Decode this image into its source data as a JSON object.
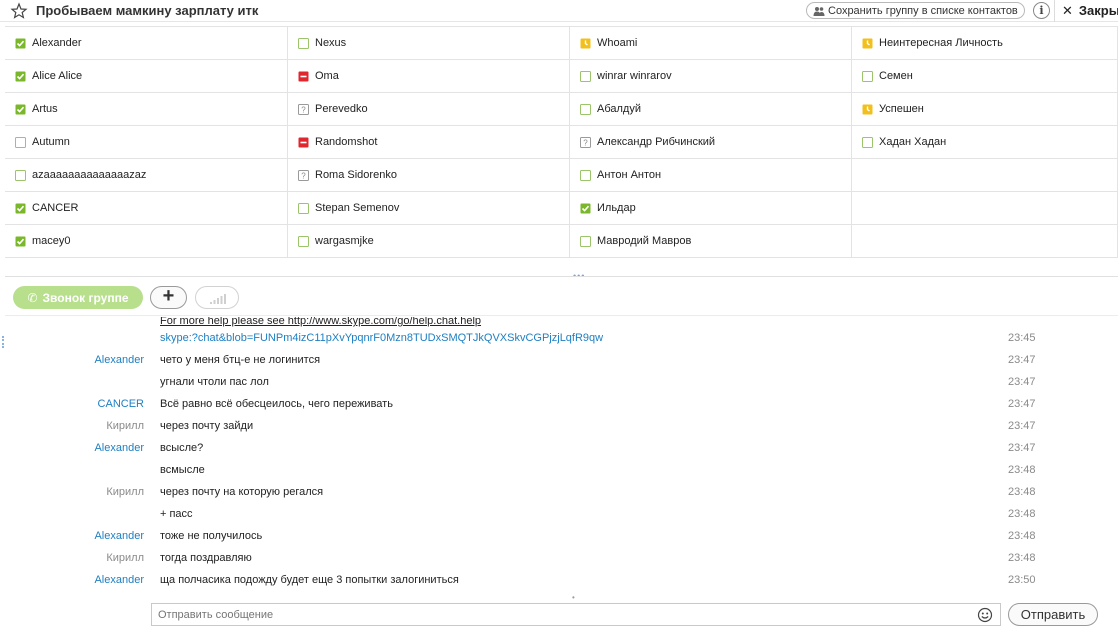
{
  "header": {
    "title": "Пробываем мамкину зарплату итк",
    "save_group_label": "Сохранить группу в списке контактов",
    "info_label": "i",
    "close_label": "Закры"
  },
  "colors": {
    "online": "#7ab72b",
    "away": "#f2c01c",
    "busy": "#e0262e",
    "offline_outline": "#9cc46a",
    "unknown": "#9a9a9a",
    "link": "#1d7fc2",
    "call_button": "#b7df8c"
  },
  "participants": [
    [
      {
        "name": "Alexander",
        "status": "online"
      },
      {
        "name": "Alice Alice",
        "status": "online"
      },
      {
        "name": "Artus",
        "status": "online"
      },
      {
        "name": "Autumn",
        "status": "offline"
      },
      {
        "name": "azaaaaaaaaaaaaaazaz",
        "status": "offline"
      },
      {
        "name": "CANCER",
        "status": "online"
      },
      {
        "name": "macey0",
        "status": "online"
      }
    ],
    [
      {
        "name": "Nexus",
        "status": "offline"
      },
      {
        "name": "Oma",
        "status": "busy"
      },
      {
        "name": "Perevedko",
        "status": "unknown"
      },
      {
        "name": "Randomshot",
        "status": "busy"
      },
      {
        "name": "Roma Sidorenko",
        "status": "unknown"
      },
      {
        "name": "Stepan Semenov",
        "status": "offline"
      },
      {
        "name": "wargasmjke",
        "status": "offline"
      }
    ],
    [
      {
        "name": "Whoami",
        "status": "away"
      },
      {
        "name": "winrar winrarov",
        "status": "offline"
      },
      {
        "name": "Абалдуй",
        "status": "offline"
      },
      {
        "name": "Александр Рибчинский",
        "status": "unknown"
      },
      {
        "name": "Антон Антон",
        "status": "offline"
      },
      {
        "name": "Ильдар",
        "status": "online"
      },
      {
        "name": "Мавродий Мавров",
        "status": "offline"
      }
    ],
    [
      {
        "name": "Неинтересная Личность",
        "status": "away"
      },
      {
        "name": "Семен",
        "status": "offline"
      },
      {
        "name": "Успешен",
        "status": "away"
      },
      {
        "name": "Хадан Хадан",
        "status": "offline"
      },
      {
        "name": "",
        "status": "none"
      },
      {
        "name": "",
        "status": "none"
      },
      {
        "name": "",
        "status": "none"
      }
    ]
  ],
  "toolbar": {
    "call_group_label": "Звонок группе",
    "add_label": "+"
  },
  "messages": [
    {
      "author": "",
      "author_style": "gray",
      "text": "For more help please see http://www.skype.com/go/help.chat.help",
      "text_style": "partial",
      "time": ""
    },
    {
      "author": "",
      "author_style": "gray",
      "text": "skype:?chat&blob=FUNPm4izC11pXvYpqnrF0Mzn8TUDxSMQTJkQVXSkvCGPjzjLqfR9qw",
      "text_style": "link",
      "time": "23:45"
    },
    {
      "author": "Alexander",
      "author_style": "blue",
      "text": "чето у меня бтц-е не логинится",
      "text_style": "",
      "time": "23:47"
    },
    {
      "author": "",
      "author_style": "gray",
      "text": "угнали чтоли пас лол",
      "text_style": "",
      "time": "23:47"
    },
    {
      "author": "CANCER",
      "author_style": "blue",
      "text": "Всё равно всё обесцеилось, чего переживать",
      "text_style": "",
      "time": "23:47"
    },
    {
      "author": "Кирилл",
      "author_style": "gray",
      "text": "через почту зайди",
      "text_style": "",
      "time": "23:47"
    },
    {
      "author": "Alexander",
      "author_style": "blue",
      "text": "всысле?",
      "text_style": "",
      "time": "23:47"
    },
    {
      "author": "",
      "author_style": "gray",
      "text": "всмысле",
      "text_style": "",
      "time": "23:48"
    },
    {
      "author": "Кирилл",
      "author_style": "gray",
      "text": "через почту на которую регался",
      "text_style": "",
      "time": "23:48"
    },
    {
      "author": "",
      "author_style": "gray",
      "text": "+ пасс",
      "text_style": "",
      "time": "23:48"
    },
    {
      "author": "Alexander",
      "author_style": "blue",
      "text": "тоже не получилось",
      "text_style": "",
      "time": "23:48"
    },
    {
      "author": "Кирилл",
      "author_style": "gray",
      "text": "тогда поздравляю",
      "text_style": "",
      "time": "23:48"
    },
    {
      "author": "Alexander",
      "author_style": "blue",
      "text": "ща полчасика подожду будет еще 3 попытки залогиниться",
      "text_style": "",
      "time": "23:50"
    }
  ],
  "composer": {
    "placeholder": "Отправить сообщение",
    "send_label": "Отправить"
  }
}
